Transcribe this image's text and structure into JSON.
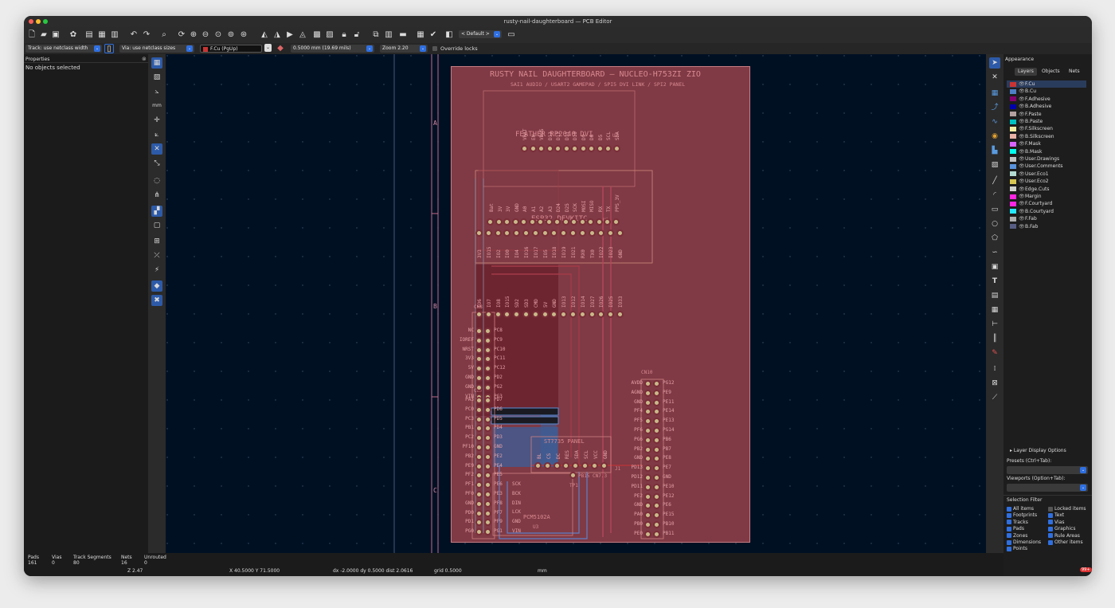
{
  "window": {
    "title": "rusty-nail-daughterboard — PCB Editor"
  },
  "toolbar2": {
    "track": "Track: use netclass width",
    "via": "Via: use netclass sizes",
    "layer": "F.Cu (PgUp)",
    "grid": "0.5000 mm (19.69 mils)",
    "zoom": "Zoom 2.20",
    "override": "Override locks"
  },
  "toolbar1": {
    "preset": "< Default >"
  },
  "properties": {
    "title": "Properties",
    "empty": "No objects selected"
  },
  "board": {
    "title": "RUSTY NAIL DAUGHTERBOARD — NUCLEO-H753ZI ZIO",
    "subtitle": "SAI1 AUDIO / USART2 GAMEPAD / SPI5 DVI LINK / SPI2 PANEL",
    "feather": "FEATHER RP2040 DVI",
    "feather_ref": "U2",
    "esp32": "ESP32 DEVKITC",
    "esp32_ref": "U1",
    "st7735": "ST7735 PANEL",
    "st7735_ref": "J1",
    "pcm": "PCM5102A",
    "pcm_ref": "U3",
    "cn8": "CN8",
    "cn7": "CN7",
    "cn10": "CN10",
    "tp1": "TP1",
    "tp1_net": "PB15 CN7.3",
    "sheet_a": "A",
    "sheet_b": "B",
    "sheet_c": "C",
    "feather_top": [
      "VBAT",
      "EN",
      "VBUS",
      "D13",
      "D12",
      "D11",
      "D10",
      "D9",
      "D6",
      "D5",
      "SCL",
      "SDA"
    ],
    "feather_bot": [
      "Bat",
      "3V",
      "3V",
      "GND",
      "A0",
      "A1",
      "A2",
      "A3",
      "D24",
      "D25",
      "SCK",
      "MOSI",
      "MISO",
      "RX",
      "TX",
      "PPS_3V"
    ],
    "esp_top": [
      "3V3",
      "IO15",
      "IO2",
      "IO0",
      "IO4",
      "IO16",
      "IO17",
      "IO5",
      "IO18",
      "IO19",
      "IO21",
      "RX0",
      "TX0",
      "IO22",
      "IO23",
      "GND"
    ],
    "esp_bot": [
      "IO6",
      "IO7",
      "IO8",
      "IO15",
      "SD2",
      "SD3",
      "CMD",
      "5V",
      "GND",
      "IO13",
      "IO12",
      "IO14",
      "IO27",
      "IO26",
      "IO25",
      "IO33"
    ],
    "cn8_left": [
      "NC",
      "IOREF",
      "NRST",
      "3V3",
      "5V",
      "GND",
      "GND",
      "VIN"
    ],
    "cn8_right": [
      "PC8",
      "PC9",
      "PC10",
      "PC11",
      "PC12",
      "PD2",
      "PG2",
      "PG3"
    ],
    "cn7_left": [
      "PA3",
      "PC0",
      "PC3",
      "PB1",
      "PC2",
      "PF10",
      "PB2",
      "PE9",
      "PF2",
      "PF1",
      "PF0",
      "GND",
      "PD0",
      "PD1",
      "PG0"
    ],
    "cn7_right": [
      "PD7",
      "PD6",
      "PD5",
      "PD4",
      "PD3",
      "GND",
      "PE2",
      "PE4",
      "PE5",
      "PE6",
      "PE3",
      "PF8",
      "PF7",
      "PF9",
      "PG1"
    ],
    "cn10_left": [
      "AVDD",
      "AGND",
      "GND",
      "PF4",
      "PF5",
      "PF6",
      "PG6",
      "PB2",
      "GND",
      "PD13",
      "PD12",
      "PD11",
      "PE2",
      "GND",
      "PA0",
      "PB0",
      "PE0"
    ],
    "cn10_right": [
      "PG12",
      "PE9",
      "PE11",
      "PE14",
      "PE13",
      "PG14",
      "PB6",
      "PB7",
      "PE8",
      "PE7",
      "GND",
      "PE10",
      "PE12",
      "PE6",
      "PE15",
      "PB10",
      "PB11"
    ],
    "st_pins": [
      "BL",
      "CS",
      "DC",
      "RES",
      "SDA",
      "SCL",
      "VCC",
      "GND"
    ],
    "pcm_pins": [
      "SCK",
      "BCK",
      "DIN",
      "LCK",
      "GND",
      "VIN"
    ]
  },
  "appearance": {
    "title": "Appearance",
    "tabs": [
      "Layers",
      "Objects",
      "Nets"
    ],
    "layers": [
      {
        "name": "F.Cu",
        "color": "#c83434"
      },
      {
        "name": "B.Cu",
        "color": "#4d7fc4"
      },
      {
        "name": "F.Adhesive",
        "color": "#84006c"
      },
      {
        "name": "B.Adhesive",
        "color": "#0000aa"
      },
      {
        "name": "F.Paste",
        "color": "#b4a0a0"
      },
      {
        "name": "B.Paste",
        "color": "#00c2c2"
      },
      {
        "name": "F.Silkscreen",
        "color": "#f2eda1"
      },
      {
        "name": "B.Silkscreen",
        "color": "#e8b2a7"
      },
      {
        "name": "F.Mask",
        "color": "#d864ff"
      },
      {
        "name": "B.Mask",
        "color": "#02ffee"
      },
      {
        "name": "User.Drawings",
        "color": "#c2c2c2"
      },
      {
        "name": "User.Comments",
        "color": "#5994dc"
      },
      {
        "name": "User.Eco1",
        "color": "#b4dbd2"
      },
      {
        "name": "User.Eco2",
        "color": "#d8c852"
      },
      {
        "name": "Edge.Cuts",
        "color": "#d0d2cd"
      },
      {
        "name": "Margin",
        "color": "#ff26e2"
      },
      {
        "name": "F.Courtyard",
        "color": "#ff26e2"
      },
      {
        "name": "B.Courtyard",
        "color": "#26e9ff"
      },
      {
        "name": "F.Fab",
        "color": "#afafaf"
      },
      {
        "name": "B.Fab",
        "color": "#585d84"
      }
    ],
    "layer_display": "Layer Display Options",
    "presets_label": "Presets (Ctrl+Tab):",
    "viewports_label": "Viewports (Option+Tab):",
    "selection_filter": "Selection Filter",
    "filters": [
      {
        "label": "All items",
        "checked": true
      },
      {
        "label": "Locked items",
        "checked": false
      },
      {
        "label": "Footprints",
        "checked": true
      },
      {
        "label": "Text",
        "checked": true
      },
      {
        "label": "Tracks",
        "checked": true
      },
      {
        "label": "Vias",
        "checked": true
      },
      {
        "label": "Pads",
        "checked": true
      },
      {
        "label": "Graphics",
        "checked": true
      },
      {
        "label": "Zones",
        "checked": true
      },
      {
        "label": "Rule Areas",
        "checked": true
      },
      {
        "label": "Dimensions",
        "checked": true
      },
      {
        "label": "Other items",
        "checked": true
      },
      {
        "label": "Points",
        "checked": true
      }
    ]
  },
  "status": {
    "pads_label": "Pads",
    "pads_val": "161",
    "vias_label": "Vias",
    "vias_val": "0",
    "tracks_label": "Track Segments",
    "tracks_val": "80",
    "nets_label": "Nets",
    "nets_val": "16",
    "unrouted_label": "Unrouted",
    "unrouted_val": "0",
    "z": "Z 2.47",
    "xy": "X 40.5000  Y 71.5000",
    "delta": "dx -2.0000  dy 0.5000  dist 2.0616",
    "grid": "grid 0.5000",
    "units": "mm",
    "badge": "99+"
  },
  "colors": {
    "accent": "#2f6fe0",
    "board": "#7f3a45",
    "canvas": "#001023"
  }
}
